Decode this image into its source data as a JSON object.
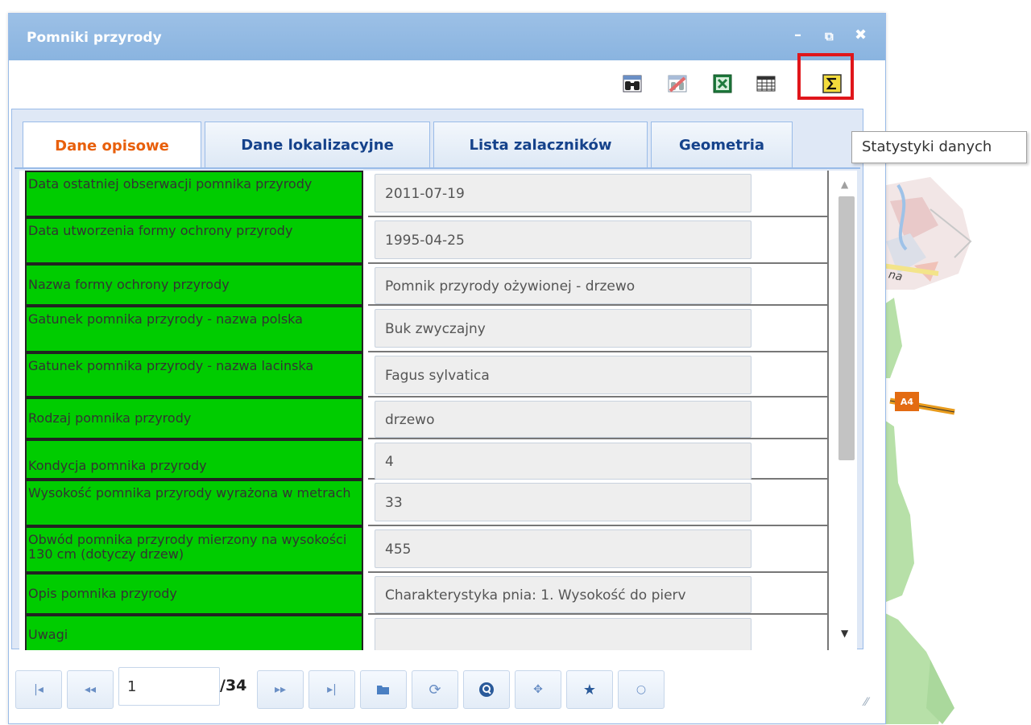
{
  "window": {
    "title": "Pomniki przyrody",
    "controls": {
      "minimize": "–",
      "popout": "⧉",
      "close": "✖"
    }
  },
  "toolbar": {
    "buttons": [
      {
        "icon": "binoculars-icon"
      },
      {
        "icon": "clear-filter-icon"
      },
      {
        "icon": "excel-export-icon"
      },
      {
        "icon": "table-columns-icon"
      },
      {
        "icon": "sigma-statistics-icon",
        "highlighted": true
      }
    ],
    "tooltip": "Statystyki danych",
    "highlight_color": "#e0161b"
  },
  "tabs": [
    {
      "label": "Dane opisowe",
      "active": true
    },
    {
      "label": "Dane lokalizacyjne",
      "active": false
    },
    {
      "label": "Lista zalaczników",
      "active": false
    },
    {
      "label": "Geometria",
      "active": false
    }
  ],
  "rows": [
    {
      "label": "Data ostatniej obserwacji pomnika przyrody",
      "value": "2011-07-19"
    },
    {
      "label": "Data utworzenia formy ochrony przyrody",
      "value": "1995-04-25"
    },
    {
      "label": "Nazwa formy ochrony przyrody",
      "value": "Pomnik przyrody ożywionej - drzewo"
    },
    {
      "label": "Gatunek pomnika przyrody - nazwa polska",
      "value": "Buk zwyczajny"
    },
    {
      "label": "Gatunek pomnika przyrody - nazwa lacinska",
      "value": "Fagus sylvatica"
    },
    {
      "label": "Rodzaj pomnika przyrody",
      "value": "drzewo"
    },
    {
      "label": "Kondycja pomnika przyrody",
      "value": "4"
    },
    {
      "label": "Wysokość pomnika przyrody wyrażona w metrach",
      "value": "33"
    },
    {
      "label": "Obwód pomnika przyrody mierzony na wysokości 130 cm (dotyczy drzew)",
      "value": "455"
    },
    {
      "label": "Opis pomnika przyrody",
      "value": "Charakterystyka pnia: 1. Wysokość do pierv"
    },
    {
      "label": "Uwagi",
      "value": ""
    }
  ],
  "pager": {
    "current_page": "1",
    "total": "/34",
    "buttons": [
      "first-page-icon",
      "prev-page-icon",
      "next-page-icon",
      "last-page-icon",
      "open-folder-icon",
      "refresh-icon",
      "zoom-icon",
      "pan-icon",
      "favorite-star-icon",
      "circle-icon"
    ]
  },
  "map": {
    "road_label": "A4",
    "street_fragment": "na"
  },
  "colors": {
    "label_bg": "#00cc00",
    "active_tab": "#e85f0b",
    "title_bar": "#8ab4e0"
  }
}
